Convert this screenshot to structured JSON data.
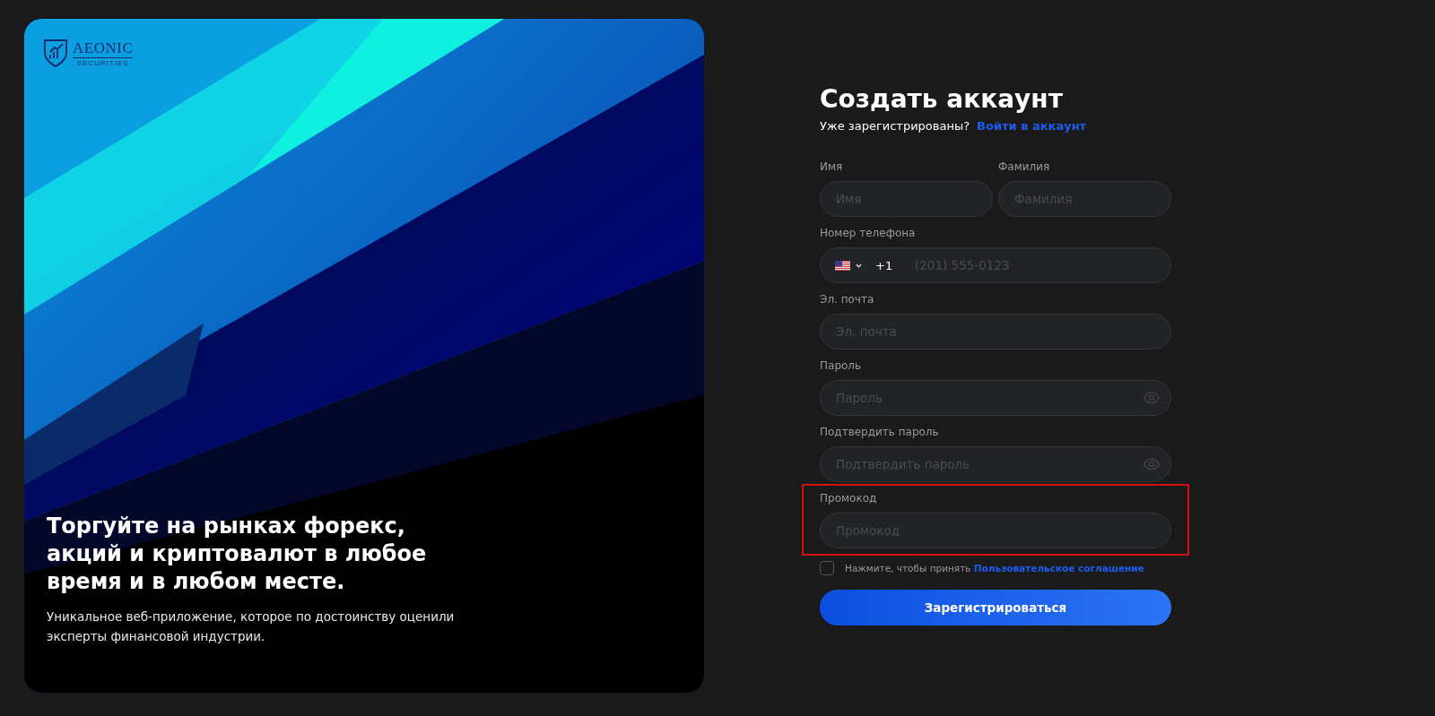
{
  "hero": {
    "kind": "picture",
    "logo": {
      "name": "AEONIC",
      "tagline": "SECURITIES"
    },
    "headline": "Торгуйте на рынках форекс, акций и криптовалют в любое время и в любом месте.",
    "text": "Уникальное веб-приложение, которое по достоинству оценили эксперты финансовой индустрии."
  },
  "form": {
    "title": "Создать аккаунт",
    "subtitle": "Уже зарегистрированы?",
    "login_link": "Войти в аккаунт",
    "name_row": [
      {
        "label": "Имя",
        "placeholder": "Имя"
      },
      {
        "label": "Фамилия",
        "placeholder": "Фамилия"
      }
    ],
    "phone": {
      "label": "Номер телефона",
      "code": "+1",
      "placeholder": "(201) 555-0123"
    },
    "fields": [
      {
        "kind": "text",
        "label": "Эл. почта",
        "placeholder": "Эл. почта",
        "highlighted": false
      },
      {
        "kind": "password",
        "label": "Пароль",
        "placeholder": "Пароль",
        "highlighted": false
      },
      {
        "kind": "password",
        "label": "Подтвердить пароль",
        "placeholder": "Подтвердить пароль",
        "highlighted": false
      },
      {
        "kind": "text",
        "label": "Промокод",
        "placeholder": "Промокод",
        "highlighted": true
      }
    ],
    "agreement": {
      "checked": false,
      "text": "Нажмите, чтобы принять",
      "link": "Пользовательское соглашение"
    },
    "submit": "Зарегистрироваться"
  }
}
